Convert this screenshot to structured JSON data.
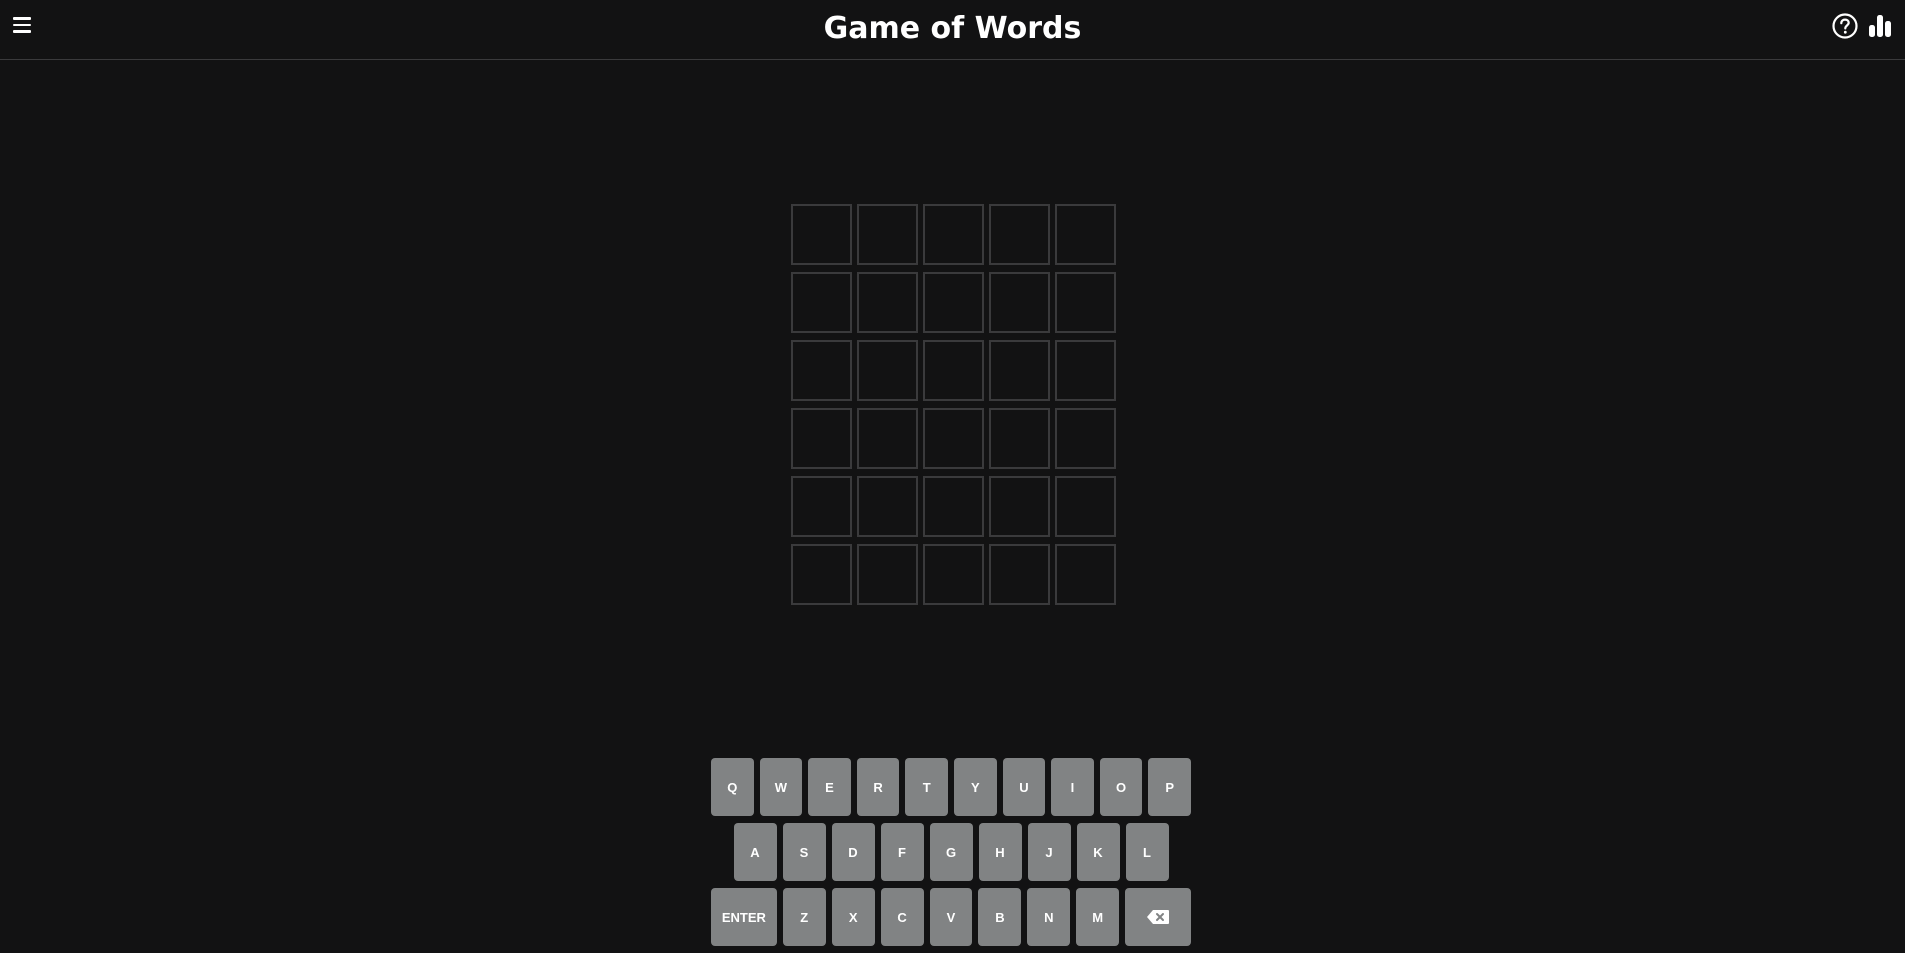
{
  "header": {
    "title": "Game of Words",
    "menu_icon": "hamburger-menu-icon",
    "help_icon": "question-circle-icon",
    "stats_icon": "bar-chart-icon"
  },
  "board": {
    "rows": 6,
    "cols": 5,
    "letters": [
      [
        "",
        "",
        "",
        "",
        ""
      ],
      [
        "",
        "",
        "",
        "",
        ""
      ],
      [
        "",
        "",
        "",
        "",
        ""
      ],
      [
        "",
        "",
        "",
        "",
        ""
      ],
      [
        "",
        "",
        "",
        "",
        ""
      ],
      [
        "",
        "",
        "",
        "",
        ""
      ]
    ]
  },
  "keyboard": {
    "rows": [
      [
        "Q",
        "W",
        "E",
        "R",
        "T",
        "Y",
        "U",
        "I",
        "O",
        "P"
      ],
      [
        "A",
        "S",
        "D",
        "F",
        "G",
        "H",
        "J",
        "K",
        "L"
      ],
      [
        "ENTER",
        "Z",
        "X",
        "C",
        "V",
        "B",
        "N",
        "M",
        "BACKSPACE"
      ]
    ],
    "backspace_icon": "backspace-icon"
  },
  "colors": {
    "background": "#121213",
    "tile_border": "#3a3a3c",
    "key_bg": "#818384",
    "text": "#ffffff"
  }
}
